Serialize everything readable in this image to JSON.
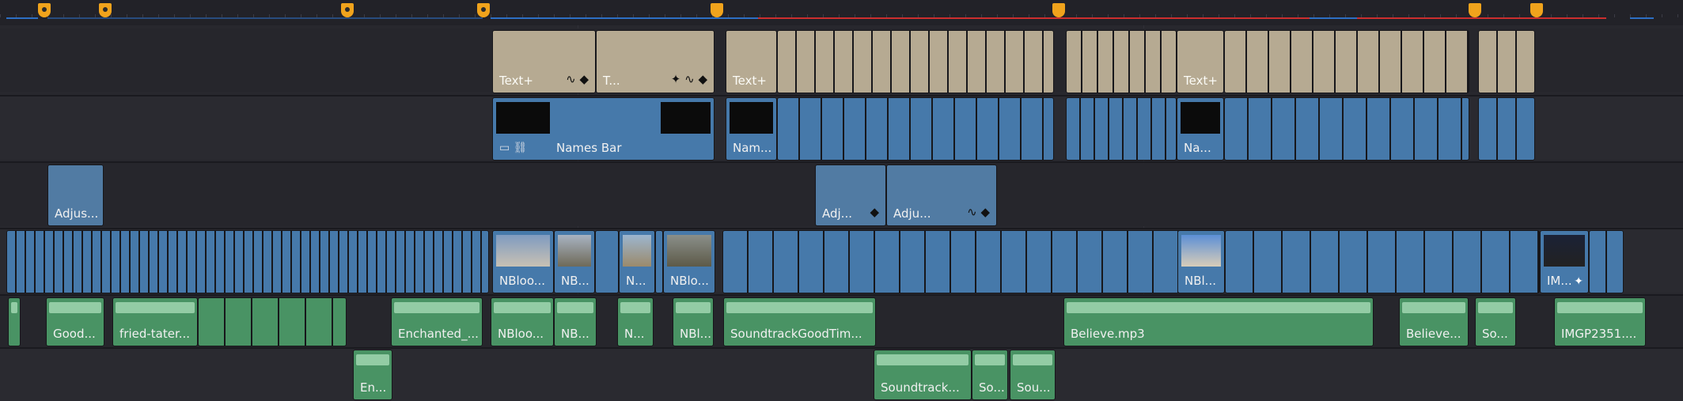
{
  "colors": {
    "background": "#28282e",
    "title_clip": "#b6aa92",
    "video_clip": "#4679aa",
    "adjustment_clip": "#517ba3",
    "audio_clip": "#499364",
    "marker": "#f0a31c",
    "range_red": "#cc2e2e",
    "range_blue": "#2d6fc4"
  },
  "markers": [
    {
      "icon": "marker-icon"
    },
    {
      "icon": "marker-icon"
    },
    {
      "icon": "marker-icon"
    },
    {
      "icon": "marker-icon"
    },
    {
      "icon": "marker-icon"
    },
    {
      "icon": "marker-icon"
    },
    {
      "icon": "marker-icon"
    },
    {
      "icon": "marker-icon"
    }
  ],
  "titles_track": {
    "clips": [
      {
        "label": "Text+"
      },
      {
        "label": "T..."
      },
      {
        "label": "Text+"
      },
      {
        "label": "Text+"
      }
    ]
  },
  "graphics_track": {
    "clips": [
      {
        "label": "Names Bar"
      },
      {
        "label": "Nam..."
      },
      {
        "label": "Na..."
      }
    ]
  },
  "adjustment_track": {
    "clips": [
      {
        "label": "Adjus..."
      },
      {
        "label": "Adj..."
      },
      {
        "label": "Adju..."
      }
    ]
  },
  "video_track": {
    "clips": [
      {
        "label": "NBloo..."
      },
      {
        "label": "NB..."
      },
      {
        "label": "N..."
      },
      {
        "label": "NBlo..."
      },
      {
        "label": "NBl..."
      },
      {
        "label": "IM..."
      }
    ]
  },
  "audio_track_1": {
    "clips": [
      {
        "label": "Good..."
      },
      {
        "label": "fried-tater..."
      },
      {
        "label": "Enchanted_..."
      },
      {
        "label": "NBloo..."
      },
      {
        "label": "NB..."
      },
      {
        "label": "N..."
      },
      {
        "label": "NBl..."
      },
      {
        "label": "SoundtrackGoodTim..."
      },
      {
        "label": "Believe.mp3"
      },
      {
        "label": "Believe..."
      },
      {
        "label": "So..."
      },
      {
        "label": "IMGP2351...."
      }
    ]
  },
  "audio_track_2": {
    "clips": [
      {
        "label": "En..."
      },
      {
        "label": "Soundtrack..."
      },
      {
        "label": "So..."
      },
      {
        "label": "Sou..."
      }
    ]
  }
}
